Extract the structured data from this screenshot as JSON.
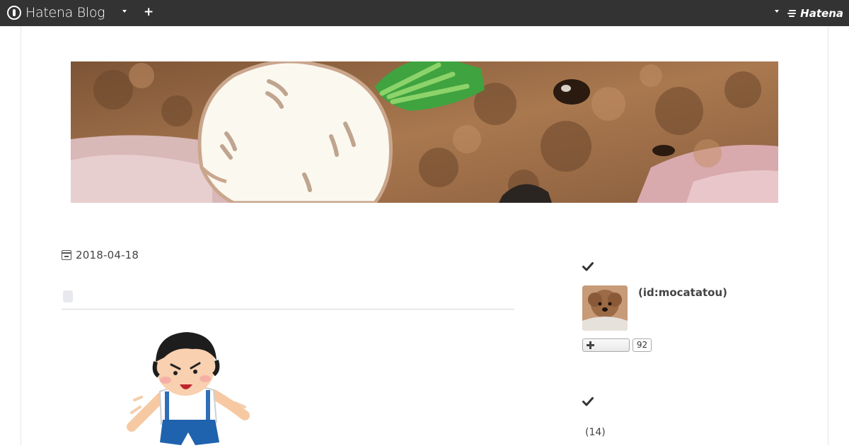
{
  "topbar": {
    "logo_text": "Hatena Blog",
    "right_logo_text": "Hatena",
    "icons": [
      "hatena-blog-logo-icon",
      "chevron-down-icon",
      "plus-icon",
      "hatena-logo-icon"
    ]
  },
  "colors": {
    "topbar_bg": "#333333",
    "page_bg": "#ffffff",
    "text": "#444444"
  },
  "article": {
    "date": "2018-04-18"
  },
  "sidebar": {
    "profile": {
      "user_id": "(id:mocatatou)",
      "follow_count": "92"
    },
    "archive": {
      "count": "(14)"
    }
  }
}
